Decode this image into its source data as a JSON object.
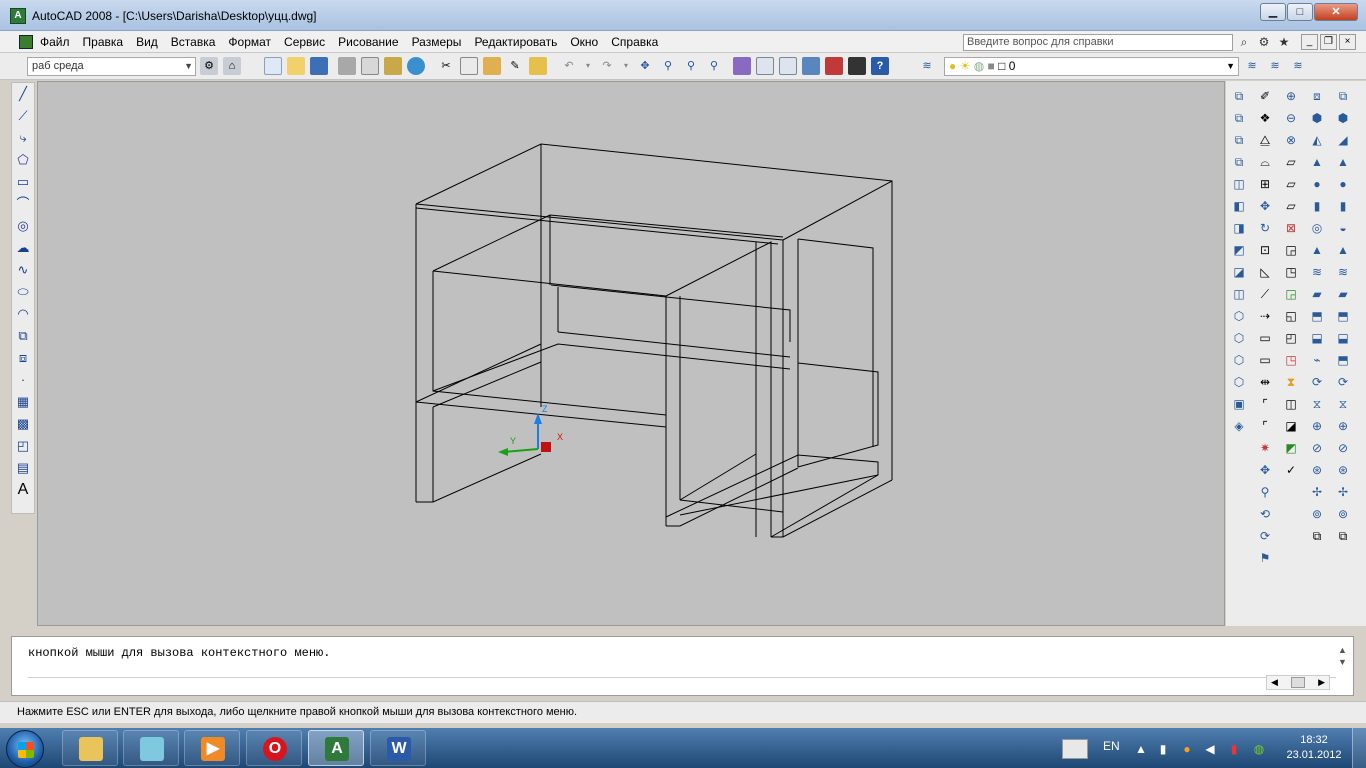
{
  "window": {
    "title": "AutoCAD 2008 - [C:\\Users\\Darisha\\Desktop\\уцц.dwg]",
    "minimize": "▁",
    "maximize": "□",
    "close": "✕"
  },
  "menu": {
    "items": [
      "Файл",
      "Правка",
      "Вид",
      "Вставка",
      "Формат",
      "Сервис",
      "Рисование",
      "Размеры",
      "Редактировать",
      "Окно",
      "Справка"
    ],
    "help_placeholder": "Введите вопрос для справки"
  },
  "toolbar": {
    "workspace": "раб среда",
    "layer_value": "0"
  },
  "command": {
    "history_line": "кнопкой мыши для вызова контекстного меню."
  },
  "status": {
    "text": "Нажмите ESC или ENTER для выхода, либо щелкните правой кнопкой мыши для вызова контекстного меню."
  },
  "ucs": {
    "x_label": "X",
    "y_label": "Y",
    "z_label": "Z"
  },
  "taskbar": {
    "language": "EN",
    "time": "18:32",
    "date": "23.01.2012"
  },
  "colors": {
    "canvas": "#c0c0c0",
    "drawing_line": "#000000",
    "ucs_x": "#d01010",
    "ucs_y": "#18a018",
    "ucs_z": "#1a7fe0"
  }
}
